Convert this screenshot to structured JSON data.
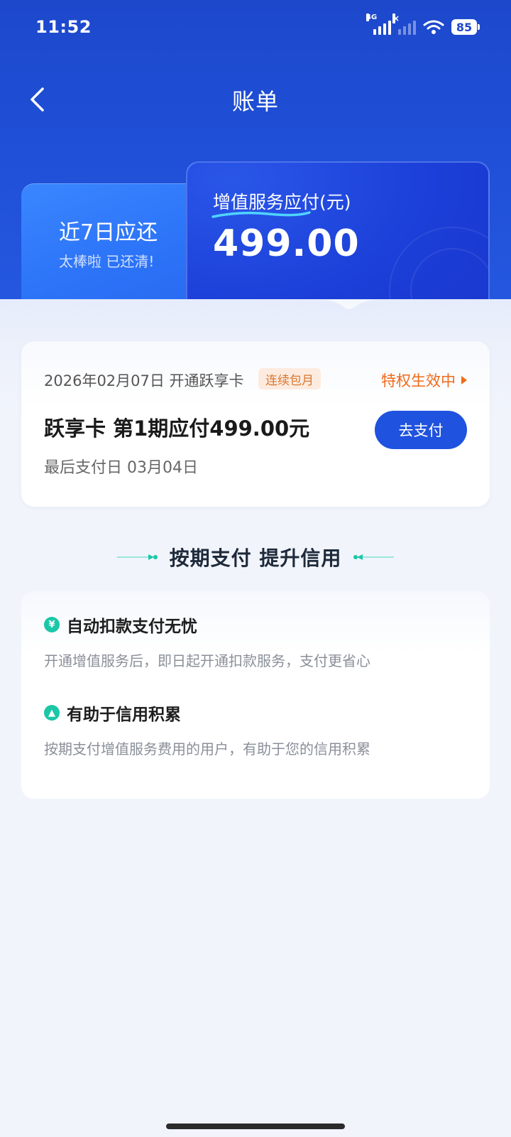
{
  "status_bar": {
    "time": "11:52",
    "network_tag": "4G",
    "battery": "85",
    "second_signal_tag": "×"
  },
  "nav": {
    "back_icon": "chevron-left-icon",
    "title": "账单"
  },
  "summary": {
    "recent": {
      "title": "近7日应还",
      "subtitle": "太棒啦 已还清!"
    },
    "value_added": {
      "label": "增值服务应付(元)",
      "amount": "499.00"
    }
  },
  "bill": {
    "date_text": "2026年02月07日 开通跃享卡",
    "tag": "连续包月",
    "status": "特权生效中",
    "title": "跃享卡 第1期应付499.00元",
    "due": "最后支付日 03月04日",
    "pay_button": "去支付"
  },
  "section": {
    "title": "按期支付 提升信用"
  },
  "benefits": [
    {
      "icon": "yen-icon",
      "icon_glyph": "¥",
      "title": "自动扣款支付无忧",
      "desc": "开通增值服务后，即日起开通扣款服务，支付更省心"
    },
    {
      "icon": "arrow-up-icon",
      "icon_glyph": "▲",
      "title": "有助于信用积累",
      "desc": "按期支付增值服务费用的用户，有助于您的信用积累"
    }
  ],
  "colors": {
    "primary": "#1f52de",
    "header_blue": "#1d48cc",
    "accent_orange": "#f06a1b",
    "benefit_green": "#1bc7a7"
  }
}
